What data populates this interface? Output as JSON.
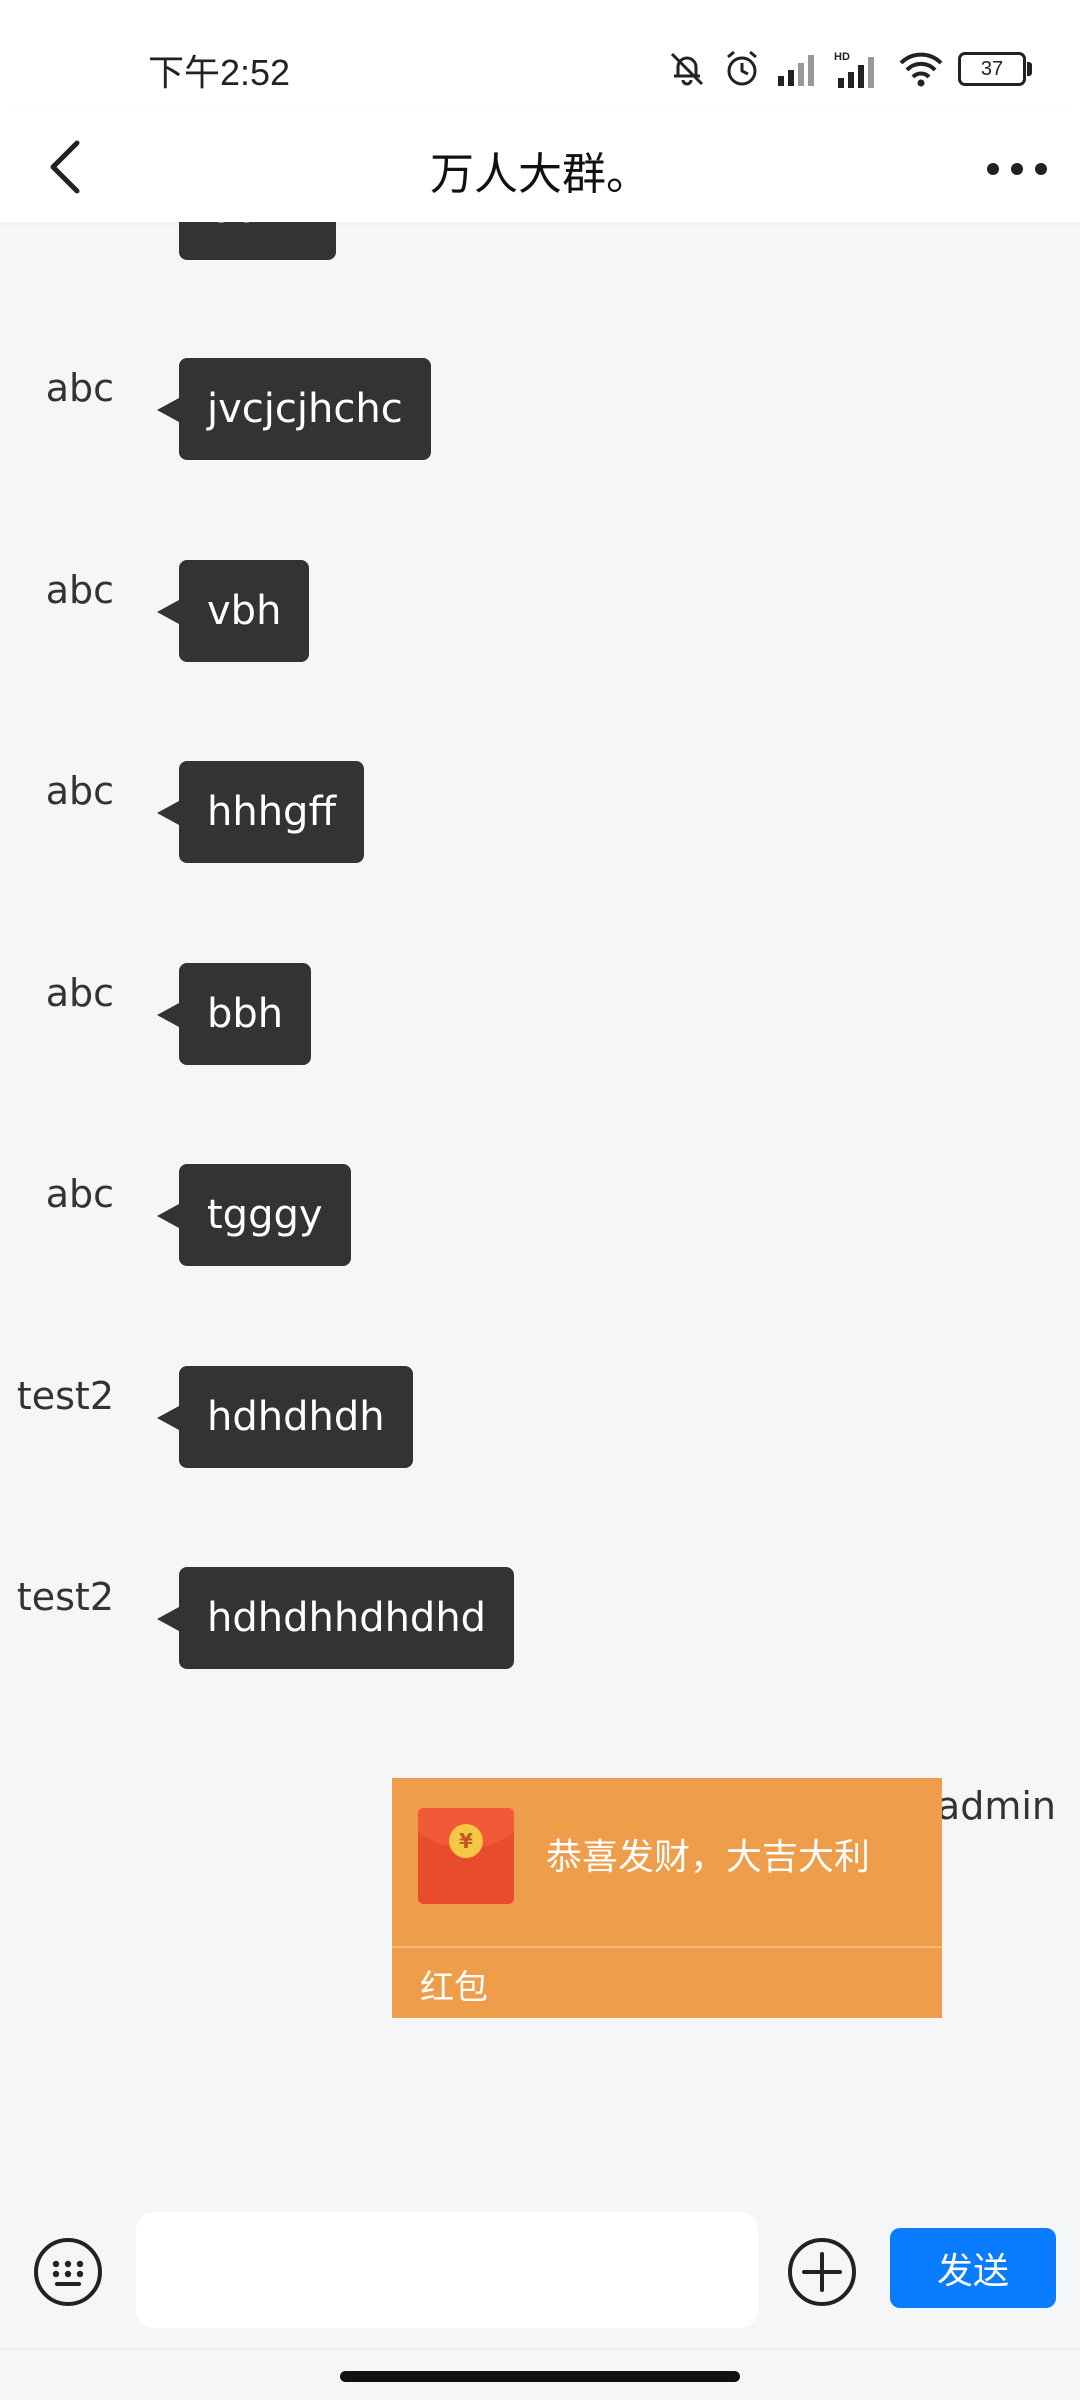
{
  "status_bar": {
    "time": "下午2:52",
    "battery": "37"
  },
  "header": {
    "title": "万人大群。"
  },
  "messages": [
    {
      "sender": "",
      "text": "bbhh"
    },
    {
      "sender": "abc",
      "text": "jvcjcjhchc"
    },
    {
      "sender": "abc",
      "text": "vbh"
    },
    {
      "sender": "abc",
      "text": "hhhgff"
    },
    {
      "sender": "abc",
      "text": "bbh"
    },
    {
      "sender": "abc",
      "text": "tgggy"
    },
    {
      "sender": "test2",
      "text": "hdhdhdh"
    },
    {
      "sender": "test2",
      "text": "hdhdhhdhdhd"
    }
  ],
  "red_packet": {
    "sender": "admin",
    "greeting": "恭喜发财，大吉大利",
    "label": "红包",
    "coin_symbol": "¥"
  },
  "input_bar": {
    "value": "",
    "send_label": "发送"
  },
  "colors": {
    "bubble": "#333333",
    "packet": "#ee9d4a",
    "send": "#0a7cff"
  }
}
